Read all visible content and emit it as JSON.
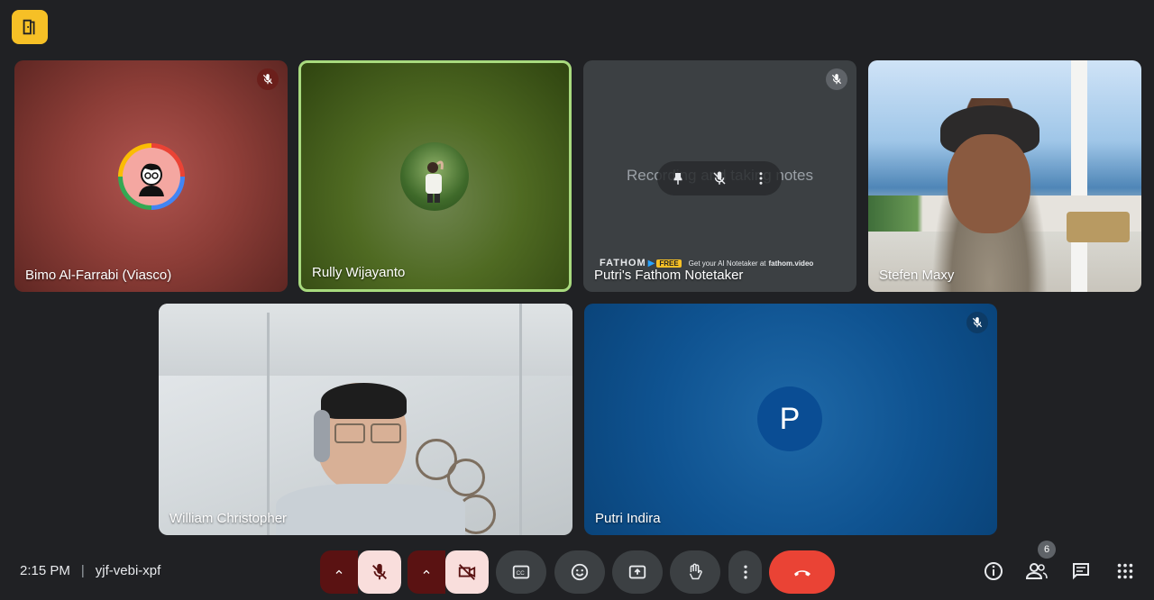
{
  "participants": [
    {
      "name": "Bimo Al-Farrabi (Viasco)",
      "muted": true
    },
    {
      "name": "Rully Wijayanto",
      "muted": false,
      "speaking": true
    },
    {
      "name": "Putri's Fathom Notetaker",
      "muted": true,
      "overlay_text": "Recording and taking notes",
      "banner_brand": "FATHOM",
      "banner_badge": "FREE",
      "banner_text": "Get your AI Notetaker at",
      "banner_link": "fathom.video"
    },
    {
      "name": "Stefen Maxy",
      "muted": false
    },
    {
      "name": "William Christopher",
      "muted": false
    },
    {
      "name": "Putri Indira",
      "muted": true,
      "initial": "P"
    }
  ],
  "bottom": {
    "time": "2:15 PM",
    "meeting_code": "yjf-vebi-xpf",
    "people_count": "6"
  },
  "colors": {
    "background": "#202124",
    "hangup": "#ea4335",
    "active_speaker": "#a8da7e",
    "muted_control": "#f9dedc"
  }
}
